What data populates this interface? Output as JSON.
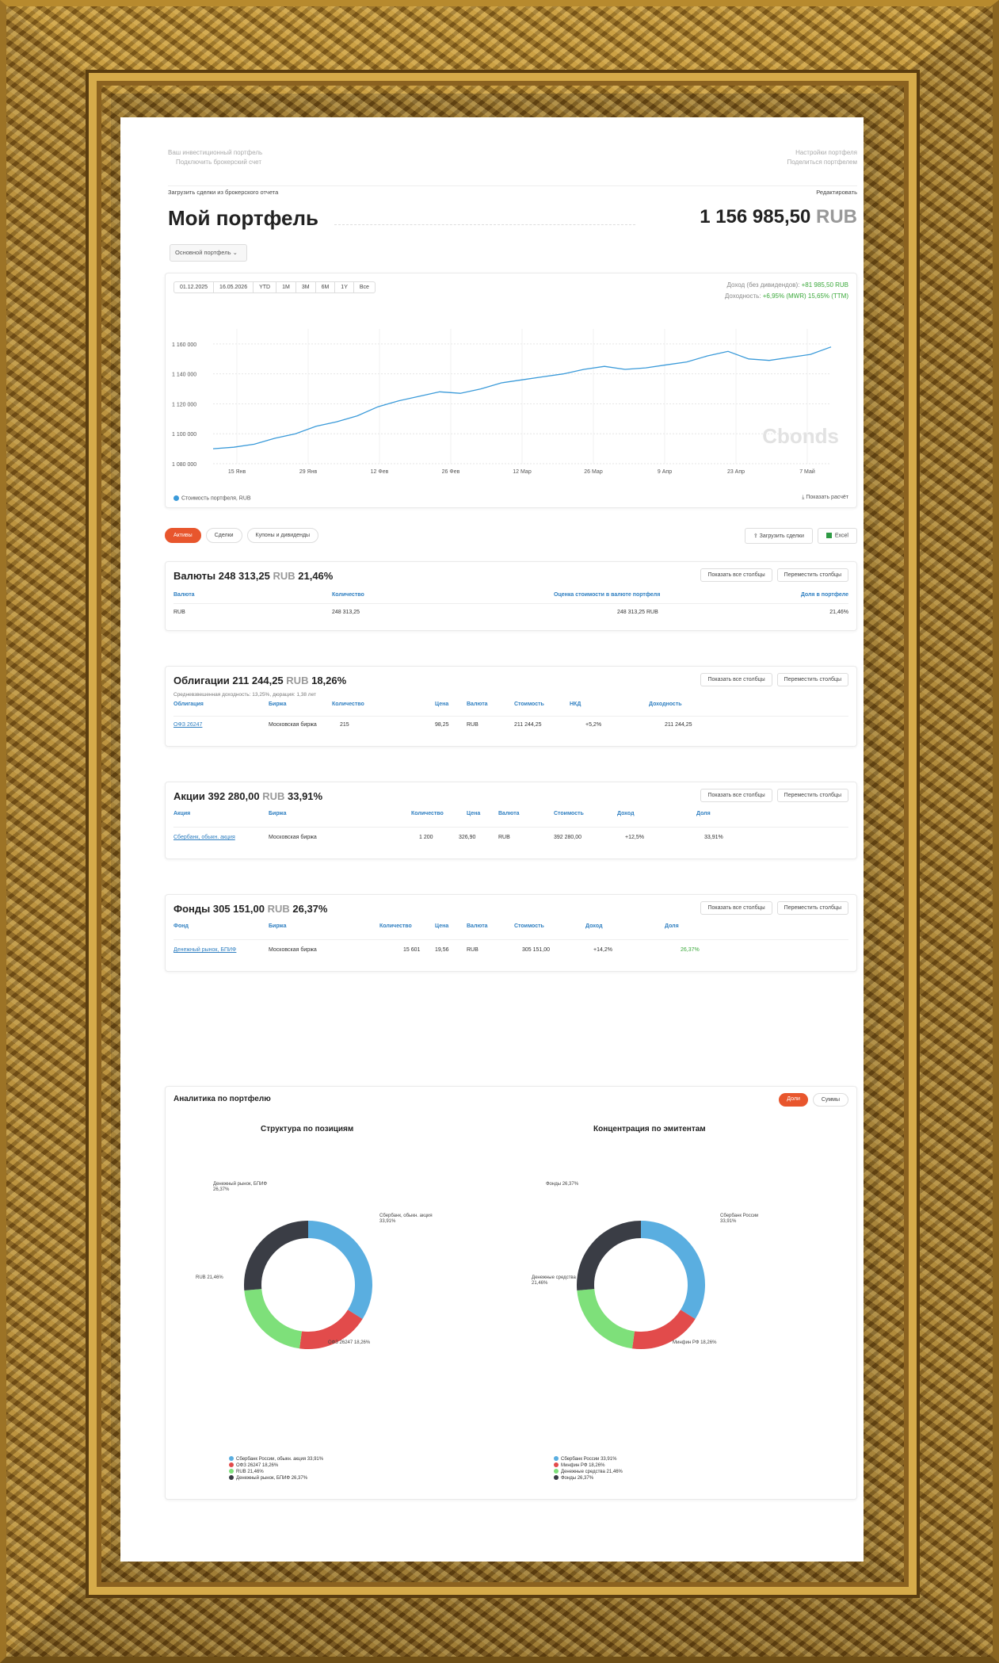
{
  "header": {
    "line1": "Ваш инвестиционный портфель",
    "line2": "Подключить брокерский счет",
    "upload": "Загрузить сделки из брокерского отчета",
    "right1": "Настройки портфеля",
    "right2": "Поделиться портфелем",
    "right3": "Редактировать"
  },
  "page": {
    "title": "Мой портфель",
    "total": "1 156 985,50",
    "currency": "RUB",
    "portfolio_select": "Основной портфель"
  },
  "chart_controls": {
    "date_from": "01.12.2025",
    "date_to": "16.05.2026",
    "periods": [
      "YTD",
      "1M",
      "3M",
      "6M",
      "1Y",
      "Все"
    ],
    "income_label": "Доход (без дивидендов):",
    "income_value": "+81 985,50 RUB",
    "yield_label": "Доходность:",
    "yield_value": "+6,95% (MWR) 15,65% (TTM)",
    "legend": "Стоимость портфеля, RUB",
    "export": "Показать расчёт",
    "watermark": "Cbonds"
  },
  "chart_data": {
    "type": "line",
    "x": [
      "15 Янв",
      "29 Янв",
      "12 Фев",
      "26 Фев",
      "12 Мар",
      "26 Мар",
      "9 Апр",
      "23 Апр",
      "7 Май"
    ],
    "yticks": [
      "1 080 000",
      "1 100 000",
      "1 120 000",
      "1 140 000",
      "1 160 000"
    ],
    "ylim": [
      1080000,
      1170000
    ],
    "series": [
      {
        "name": "Стоимость портфеля, RUB",
        "values": [
          1090000,
          1091000,
          1093000,
          1097000,
          1100000,
          1105000,
          1108000,
          1112000,
          1118000,
          1122000,
          1125000,
          1128000,
          1127000,
          1130000,
          1134000,
          1136000,
          1138000,
          1140000,
          1143000,
          1145000,
          1143000,
          1144000,
          1146000,
          1148000,
          1152000,
          1155000,
          1150000,
          1149000,
          1151000,
          1153000,
          1158000
        ]
      }
    ]
  },
  "tabs": [
    "Активы",
    "Сделки",
    "Купоны и дивиденды"
  ],
  "actions": {
    "download": "Загрузить сделки",
    "excel": "Excel"
  },
  "sections": [
    {
      "name": "Валюты",
      "amount": "248 313,25",
      "cur": "RUB",
      "pct": "21,46%",
      "btn1": "Показать все столбцы",
      "btn2": "Переместить столбцы",
      "headers": [
        "Валюта",
        "Количество",
        "Оценка стоимости в валюте портфеля",
        "Доля в портфеле"
      ],
      "rows": [
        [
          "RUB",
          "248 313,25",
          "248 313,25 RUB",
          "21,46%"
        ]
      ]
    },
    {
      "name": "Облигации",
      "amount": "211 244,25",
      "cur": "RUB",
      "pct": "18,26%",
      "sub": "Средневзвешенная доходность: 13,25%, дюрация: 1,38 лет",
      "btn1": "Показать все столбцы",
      "btn2": "Переместить столбцы",
      "headers": [
        "Облигация",
        "Биржа",
        "Количество",
        "Цена",
        "Валюта",
        "Стоимость",
        "НКД",
        "Доходность"
      ],
      "rows": [
        [
          "ОФЗ 26247",
          "Московская биржа",
          "215",
          "98,25",
          "RUB",
          "211 244,25",
          "+5,2%",
          "211 244,25"
        ]
      ]
    },
    {
      "name": "Акции",
      "amount": "392 280,00",
      "cur": "RUB",
      "pct": "33,91%",
      "btn1": "Показать все столбцы",
      "btn2": "Переместить столбцы",
      "headers": [
        "Акция",
        "Биржа",
        "Количество",
        "Цена",
        "Валюта",
        "Стоимость",
        "Доход",
        "Доля"
      ],
      "rows": [
        [
          "Сбербанк, обыкн. акция",
          "Московская биржа",
          "1 200",
          "326,90",
          "RUB",
          "392 280,00",
          "+12,5%",
          "33,91%"
        ]
      ]
    },
    {
      "name": "Фонды",
      "amount": "305 151,00",
      "cur": "RUB",
      "pct": "26,37%",
      "btn1": "Показать все столбцы",
      "btn2": "Переместить столбцы",
      "headers": [
        "Фонд",
        "Биржа",
        "Количество",
        "Цена",
        "Валюта",
        "Стоимость",
        "Доход",
        "Доля"
      ],
      "rows": [
        [
          "Денежный рынок, БПИФ",
          "Московская биржа",
          "15 601",
          "19,56",
          "RUB",
          "305 151,00",
          "+14,2%",
          "26,37%"
        ]
      ]
    }
  ],
  "analytics": {
    "title": "Аналитика по портфелю",
    "toggle_on": "Доли",
    "toggle_off": "Суммы",
    "chart1_title": "Структура по позициям",
    "chart2_title": "Концентрация по эмитентам",
    "colors": [
      "#5aaee0",
      "#e24b4b",
      "#7ee07a",
      "#3a3d45"
    ],
    "chart1_slices": [
      33.91,
      18.26,
      21.46,
      26.37
    ],
    "chart2_slices": [
      33.91,
      18.26,
      21.46,
      26.37
    ],
    "chart1_labels": [
      "Сбербанк, обыкн. акция 33,91%",
      "ОФЗ 26247 18,26%",
      "RUB 21,46%",
      "Денежный рынок, БПИФ 26,37%"
    ],
    "chart2_labels": [
      "Сбербанк России 33,91%",
      "Минфин РФ 18,26%",
      "Денежные средства 21,46%",
      "Фонды 26,37%"
    ],
    "legend1": [
      "Сбербанк России, обыкн. акция 33,91%",
      "ОФЗ 26247 18,26%",
      "RUB 21,46%",
      "Денежный рынок, БПИФ 26,37%"
    ],
    "legend2": [
      "Сбербанк России 33,91%",
      "Минфин РФ 18,26%",
      "Денежные средства 21,46%",
      "Фонды 26,37%"
    ]
  }
}
